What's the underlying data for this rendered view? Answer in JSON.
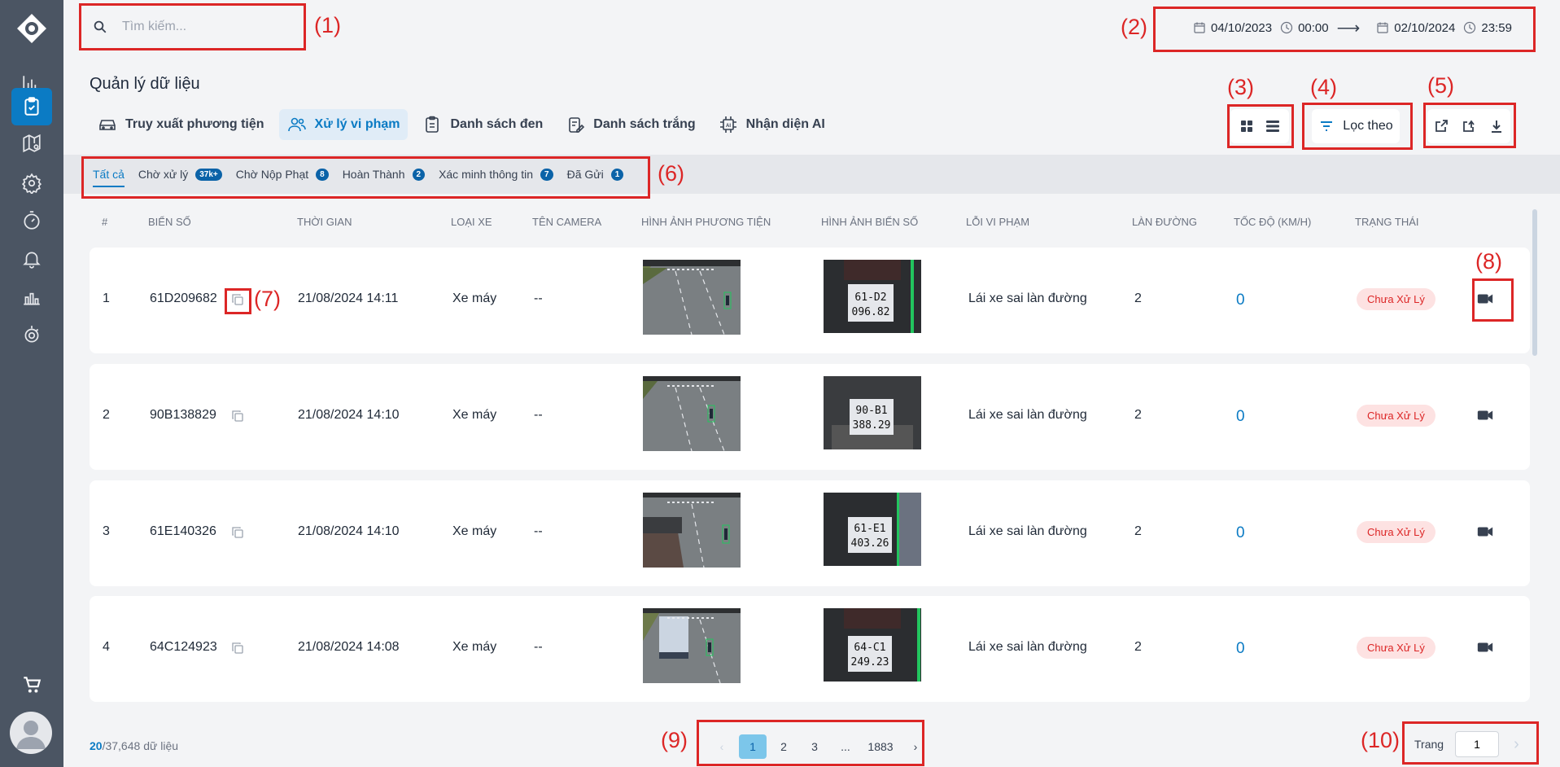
{
  "search": {
    "placeholder": "Tìm kiếm..."
  },
  "date_range": {
    "start_date": "04/10/2023",
    "start_time": "00:00",
    "arrow": "⟶",
    "end_date": "02/10/2024",
    "end_time": "23:59"
  },
  "page_title": "Quản lý dữ liệu",
  "main_tabs": [
    {
      "label": "Truy xuất phương tiện",
      "icon": "car-icon"
    },
    {
      "label": "Xử lý vi phạm",
      "icon": "users-icon",
      "active": true
    },
    {
      "label": "Danh sách đen",
      "icon": "clipboard-icon"
    },
    {
      "label": "Danh sách trắng",
      "icon": "clipboard-edit-icon"
    },
    {
      "label": "Nhận diện AI",
      "icon": "ai-chip-icon"
    }
  ],
  "toolbar": {
    "filter_label": "Lọc theo"
  },
  "status_tabs": [
    {
      "label": "Tất cả",
      "badge": "",
      "active": true
    },
    {
      "label": "Chờ xử lý",
      "badge": "37k+"
    },
    {
      "label": "Chờ Nộp Phạt",
      "badge": "8"
    },
    {
      "label": "Hoàn Thành",
      "badge": "2"
    },
    {
      "label": "Xác minh thông tin",
      "badge": "7"
    },
    {
      "label": "Đã Gửi",
      "badge": "1"
    }
  ],
  "table": {
    "headers": [
      "#",
      "BIỂN SỐ",
      "THỜI GIAN",
      "LOẠI XE",
      "TÊN CAMERA",
      "HÌNH ẢNH PHƯƠNG TIỆN",
      "HÌNH ẢNH BIỂN SỐ",
      "LỖI VI PHẠM",
      "LÀN ĐƯỜNG",
      "TỐC ĐỘ (KM/H)",
      "TRẠNG THÁI"
    ],
    "rows": [
      {
        "no": "1",
        "plate": "61D209682",
        "time": "21/08/2024 14:11",
        "vehicle": "Xe máy",
        "camera": "--",
        "plate_img_top": "61-D2",
        "plate_img_bottom": "096.82",
        "violation": "Lái xe sai làn đường",
        "lane": "2",
        "speed": "0",
        "status": "Chưa Xử Lý"
      },
      {
        "no": "2",
        "plate": "90B138829",
        "time": "21/08/2024 14:10",
        "vehicle": "Xe máy",
        "camera": "--",
        "plate_img_top": "90-B1",
        "plate_img_bottom": "388.29",
        "violation": "Lái xe sai làn đường",
        "lane": "2",
        "speed": "0",
        "status": "Chưa Xử Lý"
      },
      {
        "no": "3",
        "plate": "61E140326",
        "time": "21/08/2024 14:10",
        "vehicle": "Xe máy",
        "camera": "--",
        "plate_img_top": "61-E1",
        "plate_img_bottom": "403.26",
        "violation": "Lái xe sai làn đường",
        "lane": "2",
        "speed": "0",
        "status": "Chưa Xử Lý"
      },
      {
        "no": "4",
        "plate": "64C124923",
        "time": "21/08/2024 14:08",
        "vehicle": "Xe máy",
        "camera": "--",
        "plate_img_top": "64-C1",
        "plate_img_bottom": "249.23",
        "violation": "Lái xe sai làn đường",
        "lane": "2",
        "speed": "0",
        "status": "Chưa Xử Lý"
      }
    ]
  },
  "footer": {
    "shown": "20",
    "total": "/37,648",
    "unit": "dữ liệu",
    "pages": [
      "1",
      "2",
      "3",
      "...",
      "1883"
    ],
    "current_page": "1",
    "goto_label": "Trang",
    "goto_value": "1"
  },
  "annotations": [
    "(1)",
    "(2)",
    "(3)",
    "(4)",
    "(5)",
    "(6)",
    "(7)",
    "(8)",
    "(9)",
    "(10)"
  ],
  "colors": {
    "accent": "#0b7bc4",
    "sidebar": "#4b5563",
    "status_bg": "#fde2e2",
    "status_text": "#dc2626",
    "annotation": "#dc2626"
  }
}
